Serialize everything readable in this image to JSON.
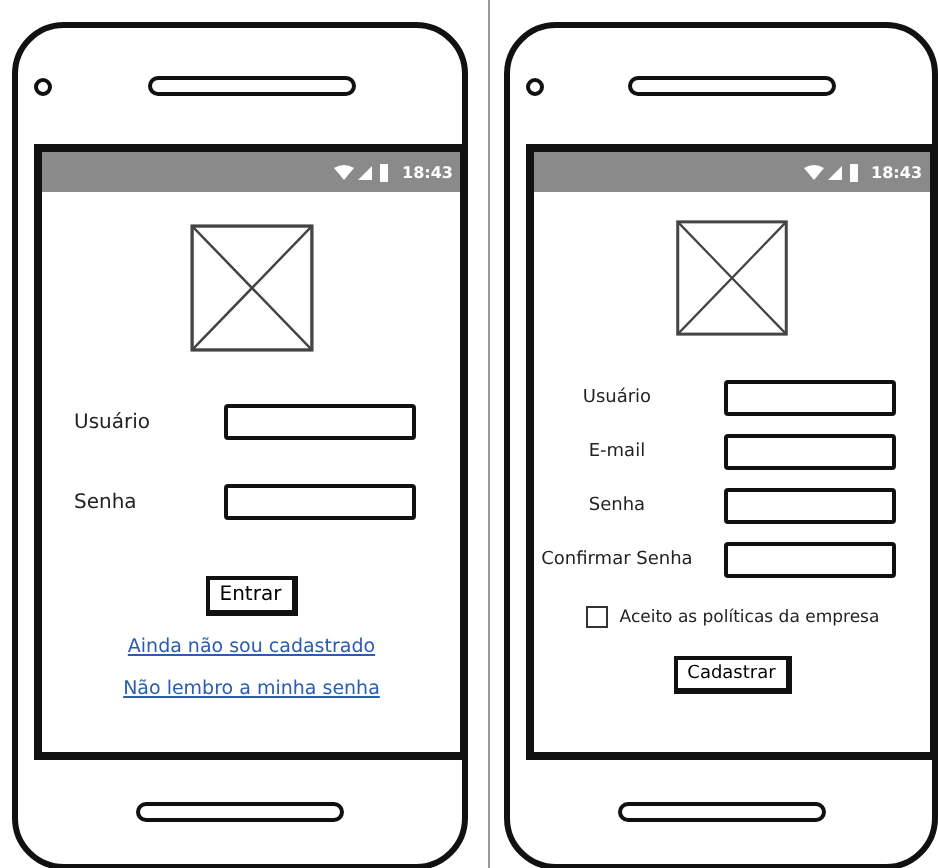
{
  "phones": [
    {
      "kind": "login",
      "status_time": "18:43",
      "fields": [
        {
          "label": "Usuário"
        },
        {
          "label": "Senha"
        }
      ],
      "button": "Entrar",
      "links": [
        "Ainda não sou cadastrado",
        "Não lembro a minha senha"
      ]
    },
    {
      "kind": "signup",
      "status_time": "18:43",
      "fields": [
        {
          "label": "Usuário"
        },
        {
          "label": "E-mail"
        },
        {
          "label": "Senha"
        },
        {
          "label": "Confirmar Senha"
        }
      ],
      "checkbox": {
        "label": "Aceito as políticas da empresa",
        "checked": false
      },
      "button": "Cadastrar"
    }
  ]
}
